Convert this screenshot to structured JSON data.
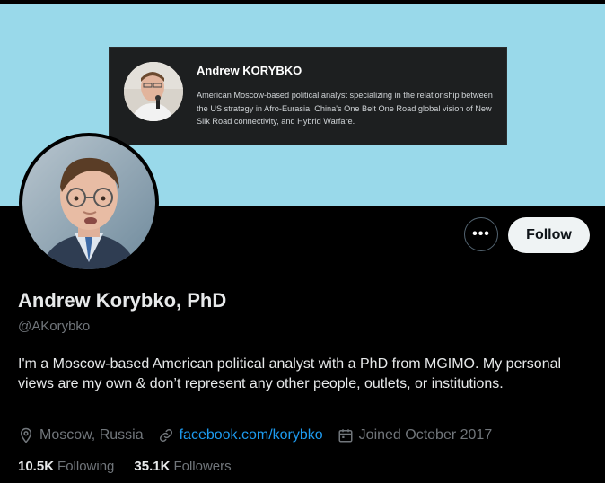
{
  "banner": {
    "card_name": "Andrew KORYBKO",
    "card_description": "American Moscow-based political analyst specializing in the relationship between the US strategy in Afro-Eurasia, China's One Belt One Road global vision of New Silk Road connectivity, and Hybrid Warfare.",
    "background_color": "#99d9ea"
  },
  "actions": {
    "more_label": "•••",
    "follow_label": "Follow"
  },
  "profile": {
    "display_name": "Andrew Korybko, PhD",
    "handle": "@AKorybko",
    "bio": "I'm a Moscow-based American political analyst with a PhD from MGIMO. My personal views are my own & don’t represent any other people, outlets, or institutions.",
    "location": "Moscow, Russia",
    "website": "facebook.com/korybko",
    "joined": "Joined October 2017"
  },
  "stats": {
    "following_count": "10.5K",
    "following_label": "Following",
    "followers_count": "35.1K",
    "followers_label": "Followers"
  },
  "icons": {
    "location": "location-pin-icon",
    "link": "link-icon",
    "calendar": "calendar-icon"
  },
  "colors": {
    "link": "#1d9bf0",
    "secondary_text": "#71767b"
  }
}
